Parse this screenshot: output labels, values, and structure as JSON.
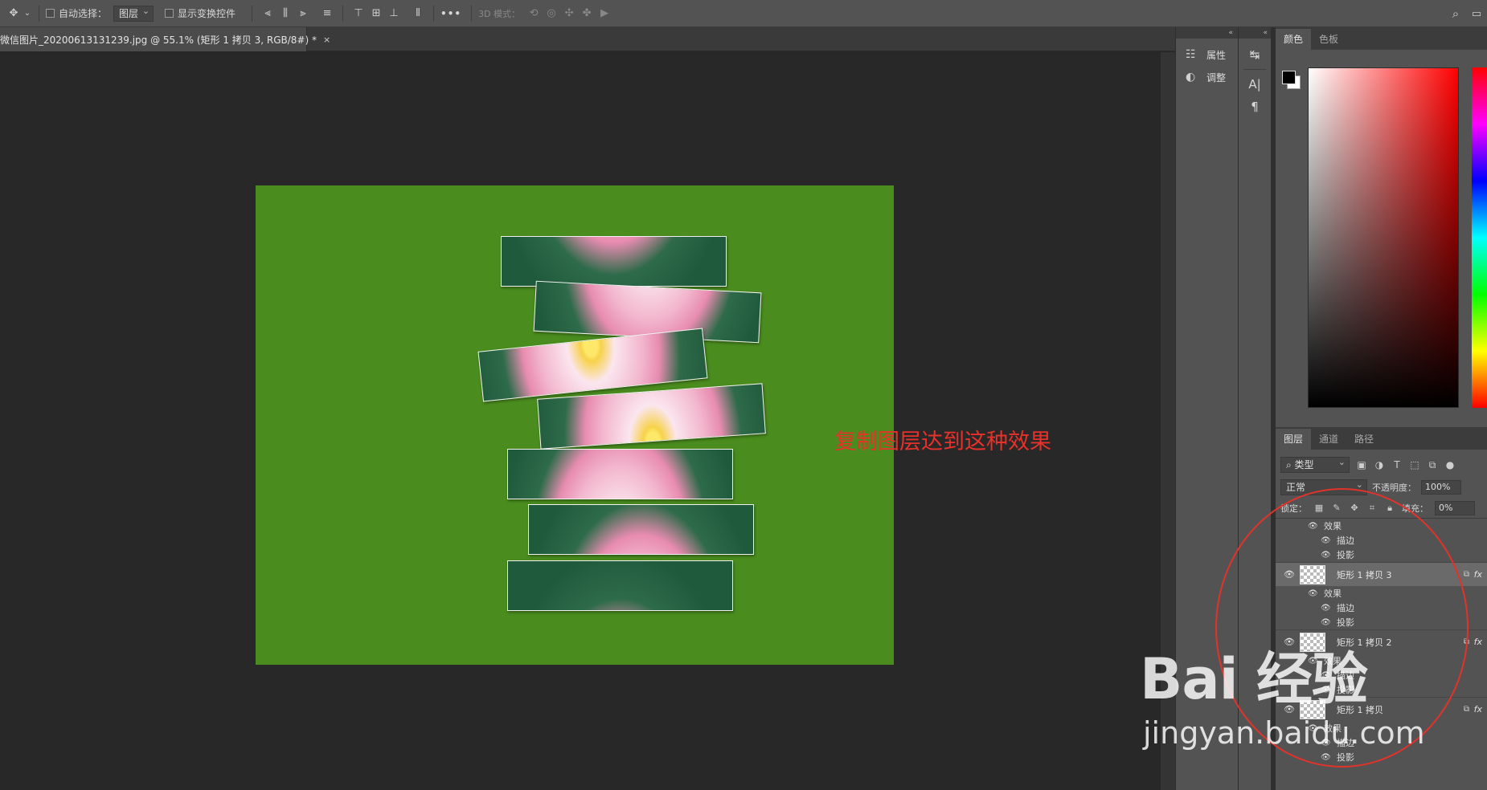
{
  "options_bar": {
    "auto_select_label": "自动选择：",
    "auto_select_value": "图层",
    "show_transform_label": "显示变换控件",
    "more_label": "•••",
    "mode_3d_label": "3D 模式："
  },
  "document": {
    "tab_title": "微信图片_20200613131239.jpg @ 55.1% (矩形 1 拷贝 3, RGB/8#) *",
    "close_label": "×",
    "canvas_color": "#4a8c1e",
    "annotation": "复制图层达到这种效果"
  },
  "dock": {
    "properties_label": "属性",
    "adjustments_label": "调整"
  },
  "color_panel": {
    "tabs": [
      "颜色",
      "色板"
    ]
  },
  "layers_panel": {
    "tabs": [
      "图层",
      "通道",
      "路径"
    ],
    "filter_type": "类型",
    "blend_mode": "正常",
    "opacity_label": "不透明度：",
    "opacity_value": "100%",
    "lock_label": "锁定：",
    "fill_label": "填充：",
    "fill_value": "0%",
    "top_effects": {
      "effects": "效果",
      "stroke": "描边",
      "shadow": "投影"
    },
    "layers": [
      {
        "name": "矩形 1 拷贝 3",
        "effects": "效果",
        "stroke": "描边",
        "shadow": "投影",
        "selected": true
      },
      {
        "name": "矩形 1 拷贝 2",
        "effects": "效果",
        "stroke": "描边",
        "shadow": "投影",
        "selected": false
      },
      {
        "name": "矩形 1 拷贝",
        "effects": "效果",
        "stroke": "描边",
        "shadow": "投影",
        "selected": false
      }
    ],
    "fx_label": "fx"
  },
  "watermark": {
    "brand": "Bai 经验",
    "site": "jingyan.baidu.com"
  },
  "accent_colors": {
    "annotation_red": "#e8312a",
    "selection_gray": "#6a6a6a"
  }
}
